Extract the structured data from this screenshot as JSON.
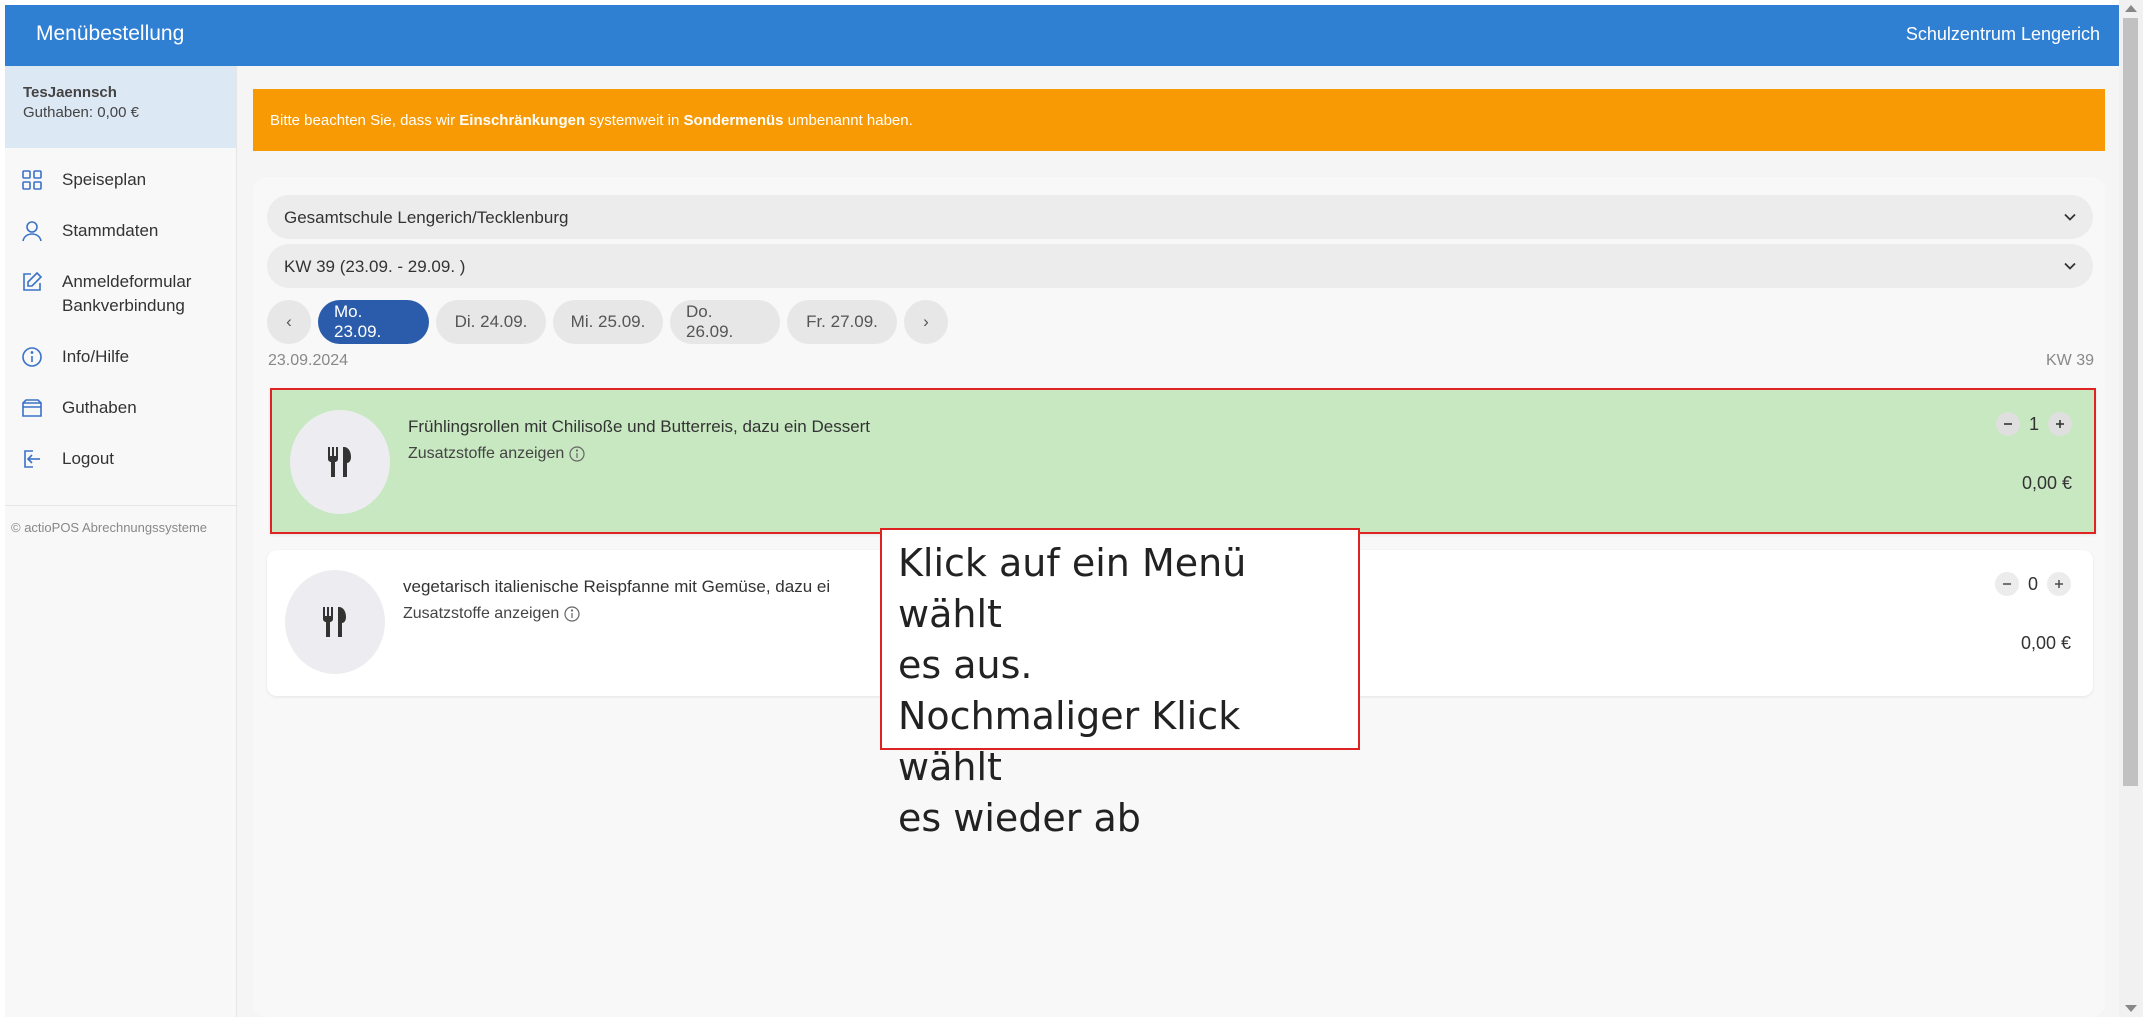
{
  "app": {
    "title": "Menübestellung",
    "organization": "Schulzentrum Lengerich"
  },
  "user": {
    "name": "TesJaennsch",
    "balance": "Guthaben: 0,00 €"
  },
  "nav": {
    "items": [
      {
        "label": "Speiseplan",
        "icon": "grid-icon"
      },
      {
        "label": "Stammdaten",
        "icon": "user-icon"
      },
      {
        "label": "Anmeldeformular Bankverbindung",
        "icon": "edit-icon"
      },
      {
        "label": "Info/Hilfe",
        "icon": "info-icon"
      },
      {
        "label": "Guthaben",
        "icon": "wallet-icon"
      },
      {
        "label": "Logout",
        "icon": "logout-icon"
      }
    ],
    "copyright": "© actioPOS Abrechnungssysteme"
  },
  "notice": {
    "part1": "Bitte beachten Sie, dass wir ",
    "bold1": "Einschränkungen",
    "part2": " systemweit in ",
    "bold2": "Sondermenüs",
    "part3": " umbenannt haben."
  },
  "filters": {
    "school": "Gesamtschule Lengerich/Tecklenburg",
    "week": "KW 39 (23.09. - 29.09. )"
  },
  "days": {
    "prev": "‹",
    "next": "›",
    "items": [
      "Mo. 23.09.",
      "Di. 24.09.",
      "Mi. 25.09.",
      "Do. 26.09.",
      "Fr. 27.09."
    ],
    "active_index": 0
  },
  "date_header": {
    "date": "23.09.2024",
    "week": "KW 39"
  },
  "menus": [
    {
      "name": "Frühlingsrollen mit Chilisoße und Butterreis, dazu ein Dessert",
      "additives": "Zusatzstoffe anzeigen",
      "quantity": "1",
      "price": "0,00 €",
      "selected": true
    },
    {
      "name": "vegetarisch italienische Reispfanne mit Gemüse, dazu ei",
      "additives": "Zusatzstoffe anzeigen",
      "quantity": "0",
      "price": "0,00 €",
      "selected": false
    }
  ],
  "callout": {
    "lines": [
      "Klick auf ein Menü wählt",
      "es aus.",
      "Nochmaliger Klick wählt",
      "es wieder ab"
    ]
  },
  "colors": {
    "header": "#2f7fd3",
    "notice": "#f79a04",
    "active_day": "#2a5cab",
    "selected_card": "#c7e8c1",
    "highlight_border": "#e02424"
  }
}
